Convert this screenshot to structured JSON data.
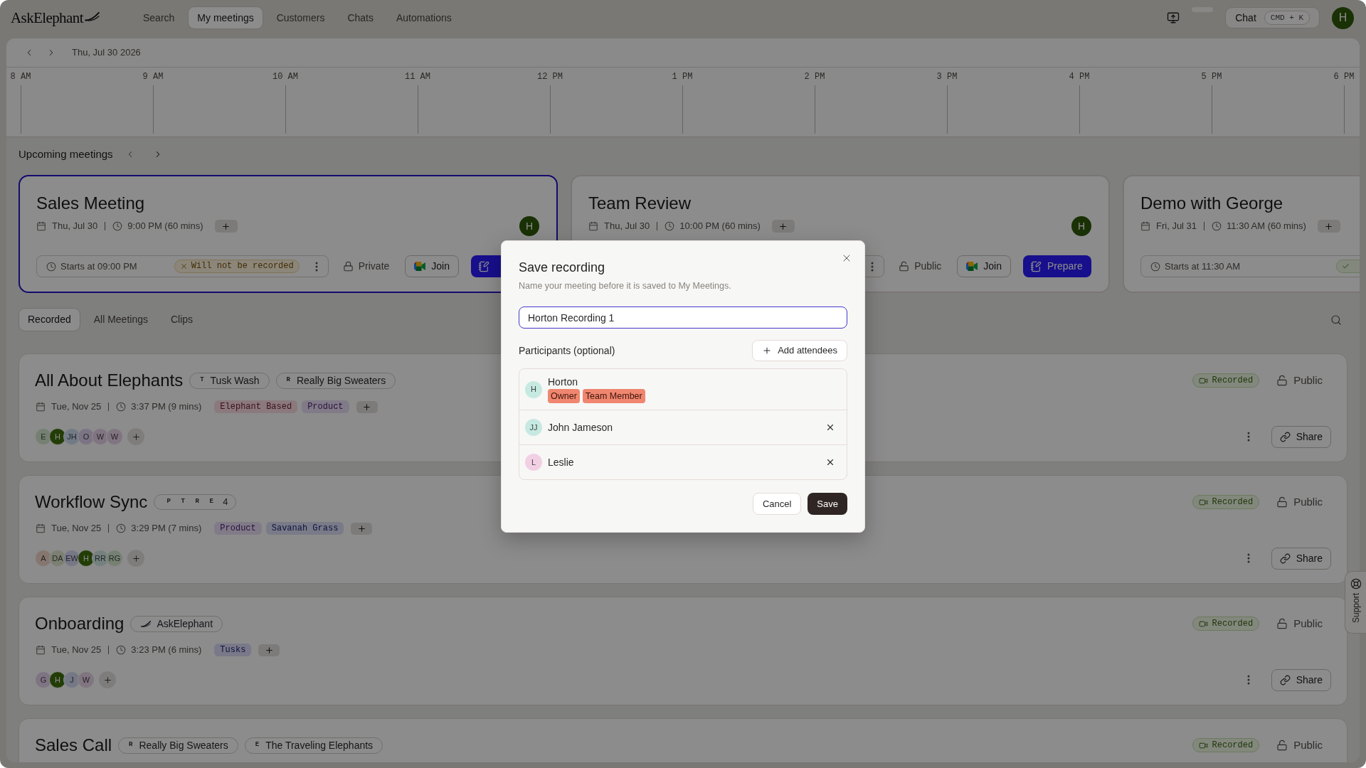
{
  "nav": {
    "logo": "AskElephant",
    "items": [
      {
        "label": "Search",
        "selected": false
      },
      {
        "label": "My meetings",
        "selected": true
      },
      {
        "label": "Customers",
        "selected": false
      },
      {
        "label": "Chats",
        "selected": false
      },
      {
        "label": "Automations",
        "selected": false
      }
    ],
    "chat": {
      "label": "Chat",
      "shortcut": "CMD + K"
    },
    "avatar": "H"
  },
  "date_bar": {
    "date": "Thu, Jul 30 2026"
  },
  "timeline": {
    "hours": [
      "8 AM",
      "9 AM",
      "10 AM",
      "11 AM",
      "12 PM",
      "1 PM",
      "2 PM",
      "3 PM",
      "4 PM",
      "5 PM",
      "6 PM"
    ]
  },
  "upcoming": {
    "title": "Upcoming meetings",
    "meetings": [
      {
        "title": "Sales Meeting",
        "selected": true,
        "date": "Thu, Jul 30",
        "time": "9:00 PM (60 mins)",
        "host": "H",
        "start": "Starts at 09:00 PM",
        "badge": {
          "kind": "not_recorded",
          "label": "Will not be recorded"
        },
        "actions": [
          {
            "kind": "private",
            "label": "Private"
          },
          {
            "kind": "join",
            "label": "Join"
          },
          {
            "kind": "prepare"
          }
        ]
      },
      {
        "title": "Team Review",
        "selected": false,
        "date": "Thu, Jul 30",
        "time": "10:00 PM (60 mins)",
        "host": "H",
        "actions": [
          {
            "kind": "public",
            "label": "Public"
          },
          {
            "kind": "join",
            "label": "Join"
          },
          {
            "kind": "prepare",
            "label": "Prepare"
          }
        ]
      },
      {
        "title": "Demo with George",
        "selected": false,
        "date": "Fri, Jul 31",
        "time": "11:30 AM (60 mins)",
        "start": "Starts at 11:30 AM",
        "badge": {
          "kind": "will_record"
        }
      }
    ]
  },
  "recordings": {
    "tabs": [
      {
        "label": "Recorded",
        "selected": true
      },
      {
        "label": "All Meetings",
        "selected": false
      },
      {
        "label": "Clips",
        "selected": false
      }
    ],
    "meetings": [
      {
        "title": "All About Elephants",
        "groups": [
          {
            "kind": "initial",
            "initial": "T",
            "name": "Tusk Wash"
          },
          {
            "kind": "initial",
            "initial": "R",
            "name": "Really Big Sweaters"
          }
        ],
        "date": "Tue, Nov 25",
        "time": "3:37 PM (9 mins)",
        "tags": [
          {
            "label": "Elephant Based",
            "color": "#8a797d"
          },
          {
            "label": "Product",
            "color": "#827b88"
          }
        ],
        "participants": [
          {
            "initials": "E",
            "color": "#758072"
          },
          {
            "initials": "H",
            "color": "#223d06"
          },
          {
            "initials": "JH",
            "color": "#727b85"
          },
          {
            "initials": "O",
            "color": "#7c7484"
          },
          {
            "initials": "W",
            "color": "#817481"
          },
          {
            "initials": "W",
            "color": "#817481"
          }
        ],
        "status": {
          "kind": "recorded",
          "label": "Recorded"
        },
        "privacy": {
          "kind": "public",
          "label": "Public"
        },
        "share": "Share"
      },
      {
        "title": "Workflow Sync",
        "groups": [
          {
            "kind": "stack",
            "initials": [
              "P",
              "T",
              "R",
              "E"
            ],
            "count": "4"
          }
        ],
        "date": "Tue, Nov 25",
        "time": "3:29 PM (7 mins)",
        "tags": [
          {
            "label": "Product",
            "color": "#827b88"
          },
          {
            "label": "Savanah Grass",
            "color": "#7a7b88"
          }
        ],
        "participants": [
          {
            "initials": "A",
            "color": "#877670"
          },
          {
            "initials": "DA",
            "color": "#7b8072"
          },
          {
            "initials": "EW",
            "color": "#767886"
          },
          {
            "initials": "H",
            "color": "#223d06"
          },
          {
            "initials": "RR",
            "color": "#74817f"
          },
          {
            "initials": "RG",
            "color": "#778173"
          }
        ],
        "status": {
          "kind": "recorded",
          "label": "Recorded"
        },
        "privacy": {
          "kind": "public",
          "label": "Public"
        },
        "share": "Share"
      },
      {
        "title": "Onboarding",
        "groups": [
          {
            "kind": "logo",
            "name": "AskElephant"
          }
        ],
        "date": "Tue, Nov 25",
        "time": "3:23 PM (6 mins)",
        "tags": [
          {
            "label": "Tusks",
            "color": "#797989"
          }
        ],
        "participants": [
          {
            "initials": "G",
            "color": "#7f7483"
          },
          {
            "initials": "H",
            "color": "#223d06"
          },
          {
            "initials": "J",
            "color": "#757986"
          },
          {
            "initials": "W",
            "color": "#807580"
          }
        ],
        "status": {
          "kind": "recorded",
          "label": "Recorded"
        },
        "privacy": {
          "kind": "public",
          "label": "Public"
        },
        "share": "Share"
      },
      {
        "title": "Sales Call",
        "groups": [
          {
            "kind": "initial",
            "initial": "R",
            "name": "Really Big Sweaters"
          },
          {
            "kind": "initial",
            "initial": "E",
            "name": "The Traveling Elephants"
          }
        ],
        "status": {
          "kind": "recorded",
          "label": "Recorded"
        },
        "privacy": {
          "kind": "public",
          "label": "Public"
        }
      }
    ]
  },
  "support": {
    "label": "Support"
  },
  "dialog": {
    "title": "Save recording",
    "description": "Name your meeting before it is saved to My Meetings.",
    "name_value": "Horton Recording 1",
    "participants_label": "Participants (optional)",
    "add_button": "Add attendees",
    "participants": [
      {
        "initials": "H",
        "name": "Horton",
        "color": "#c6e9e1",
        "roles": [
          "Owner",
          "Team Member"
        ],
        "removable": false
      },
      {
        "initials": "JJ",
        "name": "John Jameson",
        "color": "#c6e9e1",
        "removable": true
      },
      {
        "initials": "L",
        "name": "Leslie",
        "color": "#f2d0e4",
        "removable": true
      }
    ],
    "cancel": "Cancel",
    "save": "Save"
  }
}
